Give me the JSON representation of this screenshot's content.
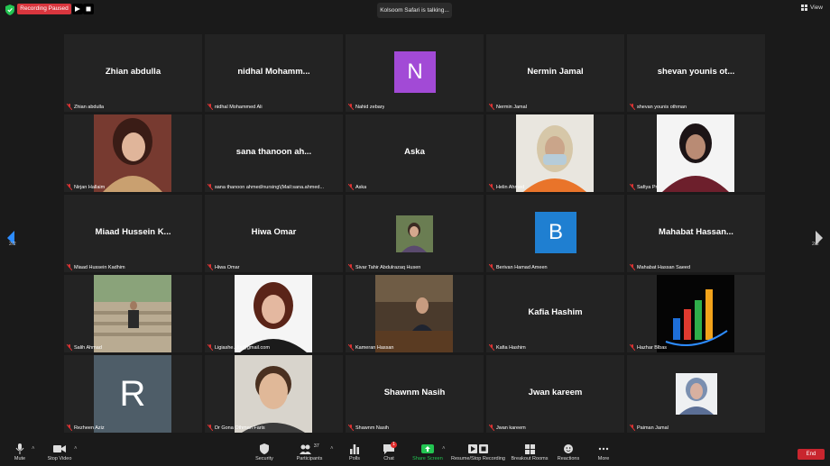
{
  "topbar": {
    "recording_status": "Recording Paused",
    "talking": "Kolsoom Safari is talking...",
    "view_label": "View"
  },
  "tiles": [
    {
      "name": "Zhian abdulla",
      "big": "Zhian abdulla",
      "kind": "text"
    },
    {
      "name": "nidhal Mohammed Ali",
      "big": "nidhal  Mohamm...",
      "kind": "text"
    },
    {
      "name": "Nahid zebary",
      "big": "N",
      "kind": "letter",
      "color": "#a24ad6"
    },
    {
      "name": "Nermin Jamal",
      "big": "Nermin Jamal",
      "kind": "text"
    },
    {
      "name": "shevan younis othman",
      "big": "shevan  younis ot...",
      "kind": "text"
    },
    {
      "name": "Nirjan Hallaim",
      "big": "",
      "kind": "photo"
    },
    {
      "name": "sana thanoon ahmed/nursing\\(Mail:sana.ahmed...",
      "big": "sana thanoon ah...",
      "kind": "text"
    },
    {
      "name": "Aska",
      "big": "Aska",
      "kind": "text"
    },
    {
      "name": "Helin Ahmed",
      "big": "",
      "kind": "photo"
    },
    {
      "name": "Safiya Pro",
      "big": "",
      "kind": "photo"
    },
    {
      "name": "Miaad Hussein Kadhim",
      "big": "Miaad  Hussein  K...",
      "kind": "text"
    },
    {
      "name": "Hiwa Omar",
      "big": "Hiwa Omar",
      "kind": "text"
    },
    {
      "name": "Sivar Tahir Abdulrazaq Husen",
      "big": "",
      "kind": "photo"
    },
    {
      "name": "Berivan Hamad Ameen",
      "big": "B",
      "kind": "letter",
      "color": "#1f7fd1"
    },
    {
      "name": "Mahabat Hassan Saeed",
      "big": "Mahabat  Hassan...",
      "kind": "text"
    },
    {
      "name": "Salih Ahmad",
      "big": "",
      "kind": "photo"
    },
    {
      "name": "Ligiashe...lis@gmail.com",
      "big": "",
      "kind": "photo"
    },
    {
      "name": "Kameran Hassan",
      "big": "",
      "kind": "photo"
    },
    {
      "name": "Kafia Hashim",
      "big": "Kafia Hashim",
      "kind": "text"
    },
    {
      "name": "Hazhar Blbas",
      "big": "",
      "kind": "photo"
    },
    {
      "name": "Rezheen Aziz",
      "big": "R",
      "kind": "letter",
      "color": "#4e5d68"
    },
    {
      "name": "Dr Gona Othman Faris",
      "big": "",
      "kind": "photo"
    },
    {
      "name": "Shawnm Nasih",
      "big": "Shawnm Nasih",
      "kind": "text"
    },
    {
      "name": "Jwan kareem",
      "big": "Jwan kareem",
      "kind": "text"
    },
    {
      "name": "Paiman Jamal",
      "big": "",
      "kind": "photo"
    }
  ],
  "pager": {
    "left": "2/2",
    "right": "2/2"
  },
  "toolbar": {
    "mute": "Mute",
    "stop_video": "Stop Video",
    "security": "Security",
    "participants": "Participants",
    "participants_count": "37",
    "polls": "Polls",
    "chat": "Chat",
    "chat_badge": "1",
    "share_screen": "Share Screen",
    "recording": "Resume/Stop Recording",
    "breakout": "Breakout Rooms",
    "reactions": "Reactions",
    "more": "More",
    "end": "End"
  },
  "colors": {
    "accent_green": "#23c552",
    "record_red": "#d9363e",
    "end_red": "#c9252e",
    "nav_blue": "#2d8cff"
  }
}
